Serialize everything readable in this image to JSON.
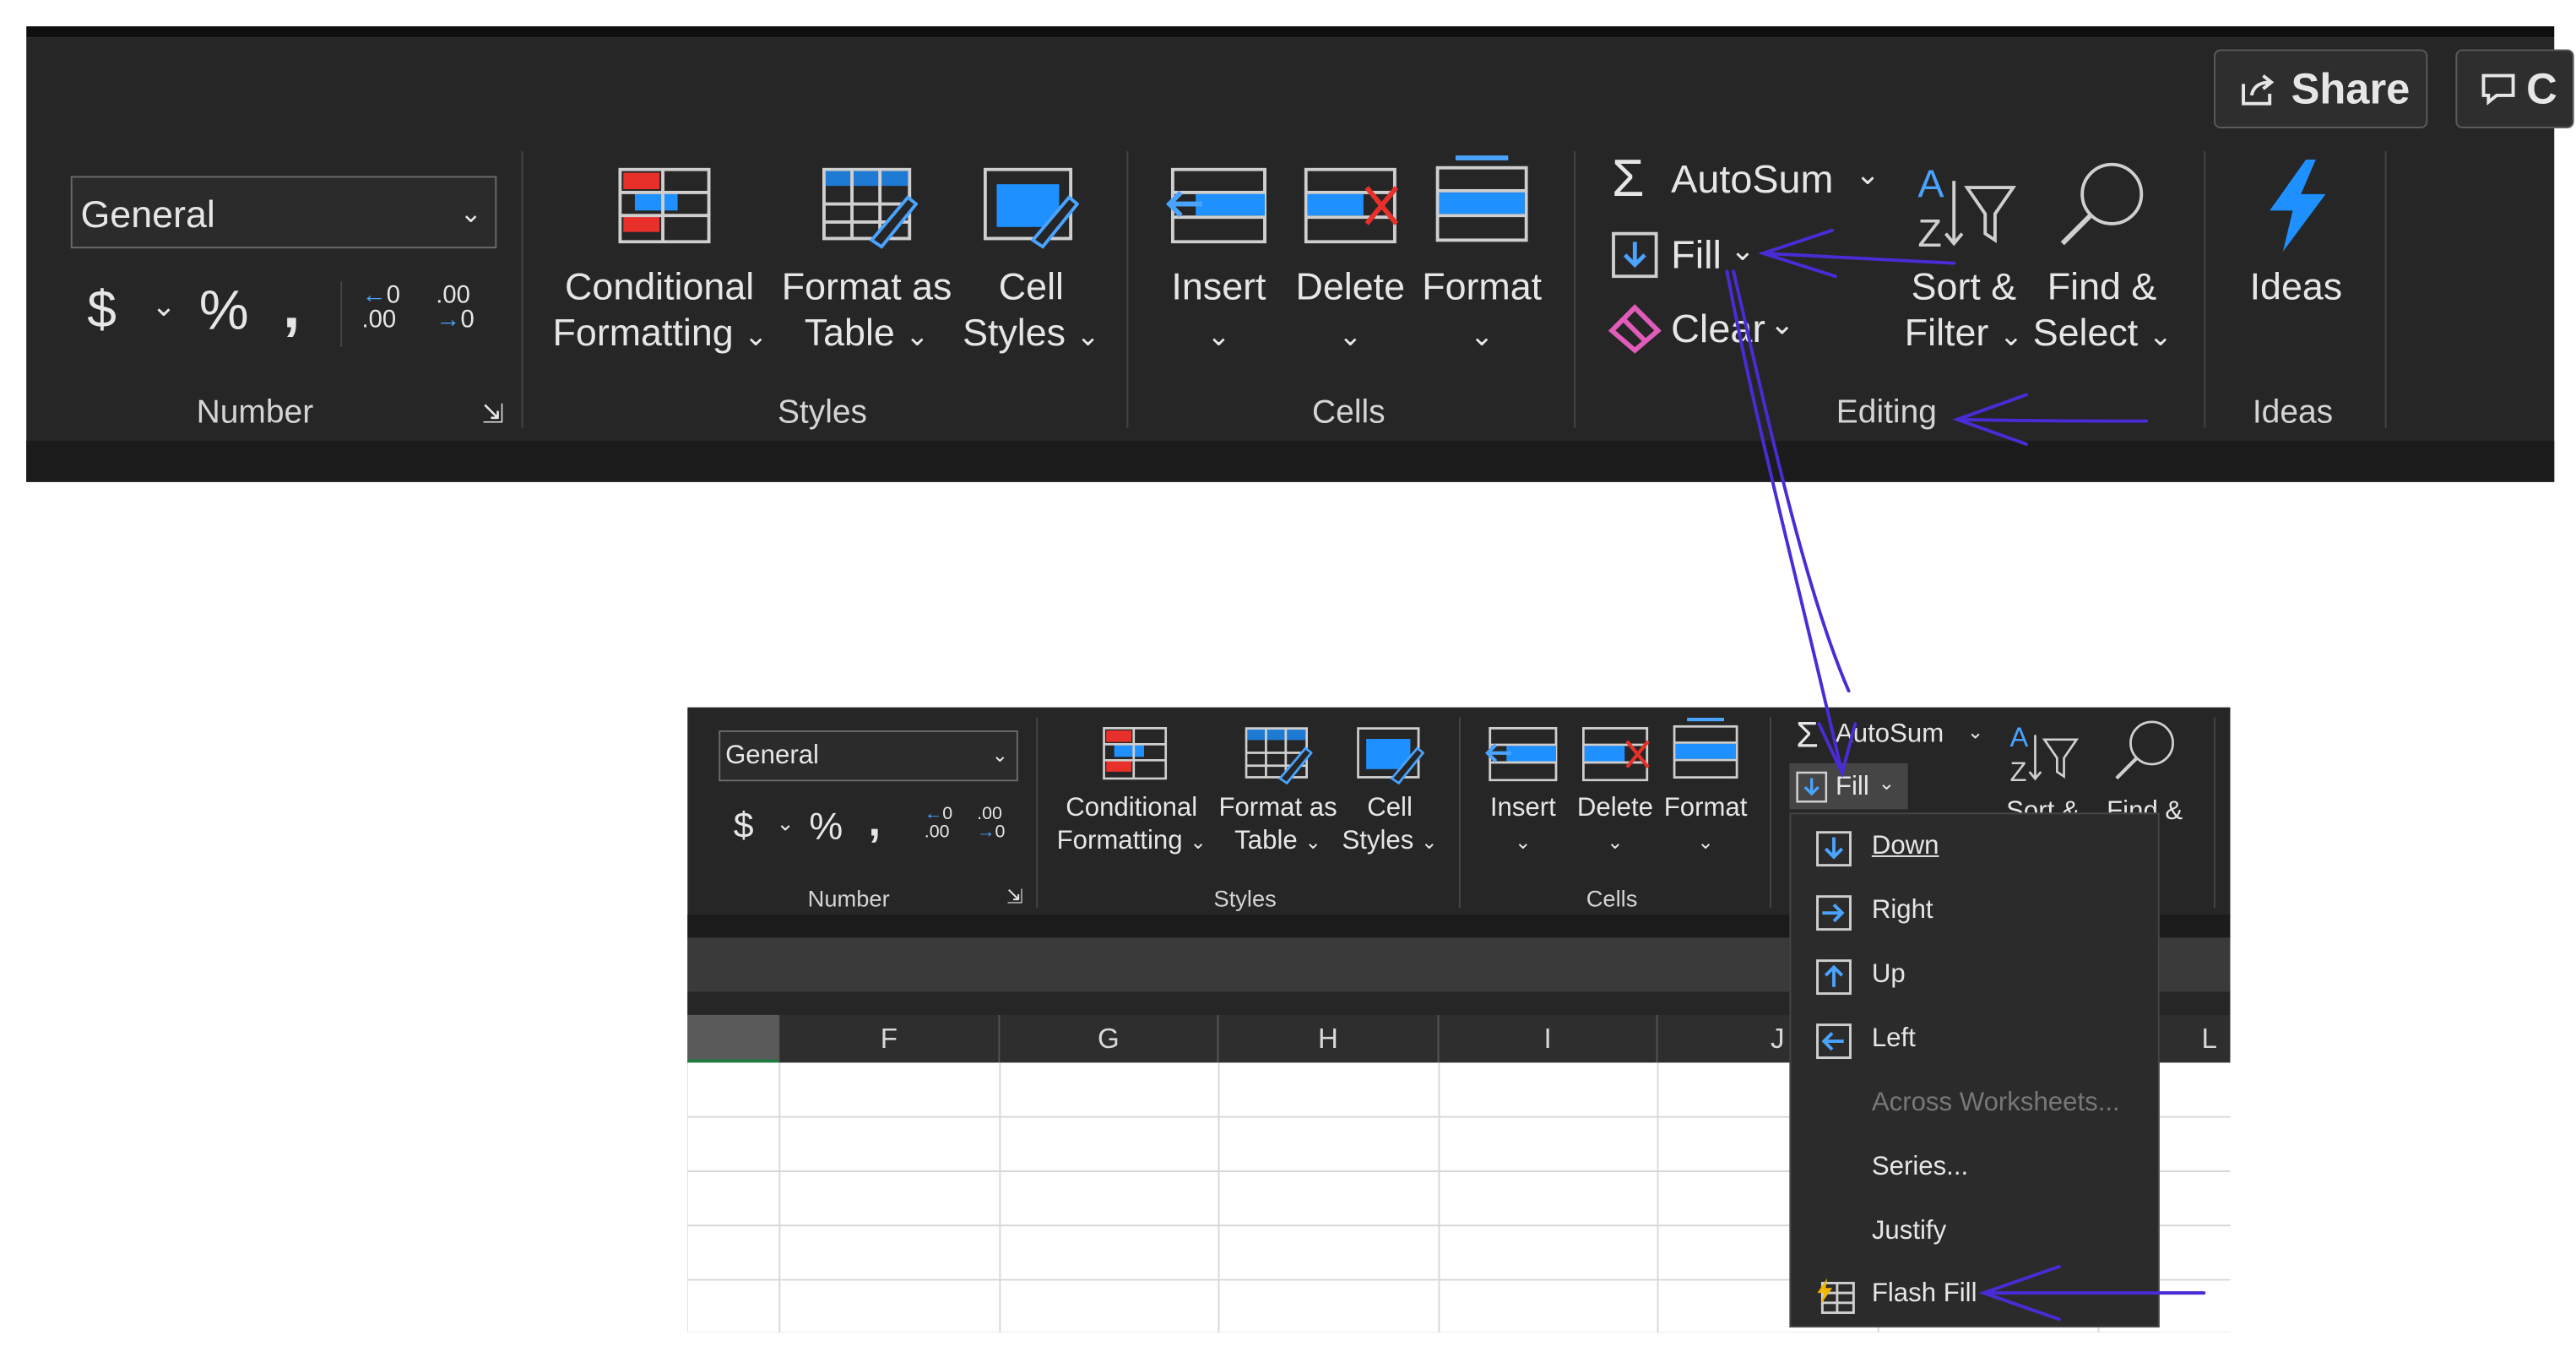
{
  "top": {
    "share_label": "Share",
    "comments_partial": "C",
    "number_format": "General",
    "number_group": "Number",
    "styles": {
      "conditional_line1": "Conditional",
      "conditional_line2": "Formatting",
      "format_table_line1": "Format as",
      "format_table_line2": "Table",
      "cell_styles_line1": "Cell",
      "cell_styles_line2": "Styles",
      "group": "Styles"
    },
    "cells": {
      "insert": "Insert",
      "delete": "Delete",
      "format": "Format",
      "group": "Cells"
    },
    "editing": {
      "autosum": "AutoSum",
      "fill": "Fill",
      "clear": "Clear",
      "sort_line1": "Sort &",
      "sort_line2": "Filter",
      "find_line1": "Find &",
      "find_line2": "Select",
      "group": "Editing"
    },
    "ideas": {
      "label": "Ideas",
      "group": "Ideas"
    }
  },
  "bottom": {
    "number_format": "General",
    "number_group": "Number",
    "styles": {
      "conditional_line1": "Conditional",
      "conditional_line2": "Formatting",
      "format_table_line1": "Format as",
      "format_table_line2": "Table",
      "cell_styles_line1": "Cell",
      "cell_styles_line2": "Styles",
      "group": "Styles"
    },
    "cells": {
      "insert": "Insert",
      "delete": "Delete",
      "format": "Format",
      "group": "Cells"
    },
    "editing": {
      "autosum": "AutoSum",
      "fill": "Fill",
      "sort_partial": "Sort &",
      "find_line1": "Find &"
    },
    "columns": [
      "F",
      "G",
      "H",
      "I",
      "J",
      "L"
    ],
    "fill_menu": [
      {
        "label": "Down",
        "icon": "fill-down-icon",
        "disabled": false
      },
      {
        "label": "Right",
        "icon": "fill-right-icon",
        "disabled": false
      },
      {
        "label": "Up",
        "icon": "fill-up-icon",
        "disabled": false
      },
      {
        "label": "Left",
        "icon": "fill-left-icon",
        "disabled": false
      },
      {
        "label": "Across Worksheets...",
        "icon": "",
        "disabled": true
      },
      {
        "label": "Series...",
        "icon": "",
        "disabled": false
      },
      {
        "label": "Justify",
        "icon": "",
        "disabled": false
      },
      {
        "label": "Flash Fill",
        "icon": "flash-fill-icon",
        "disabled": false
      }
    ]
  },
  "colors": {
    "ribbon_bg": "#262626",
    "accent_blue": "#1e90ff",
    "accent_red": "#e8302a",
    "annotation_purple": "#4b2bd6"
  }
}
